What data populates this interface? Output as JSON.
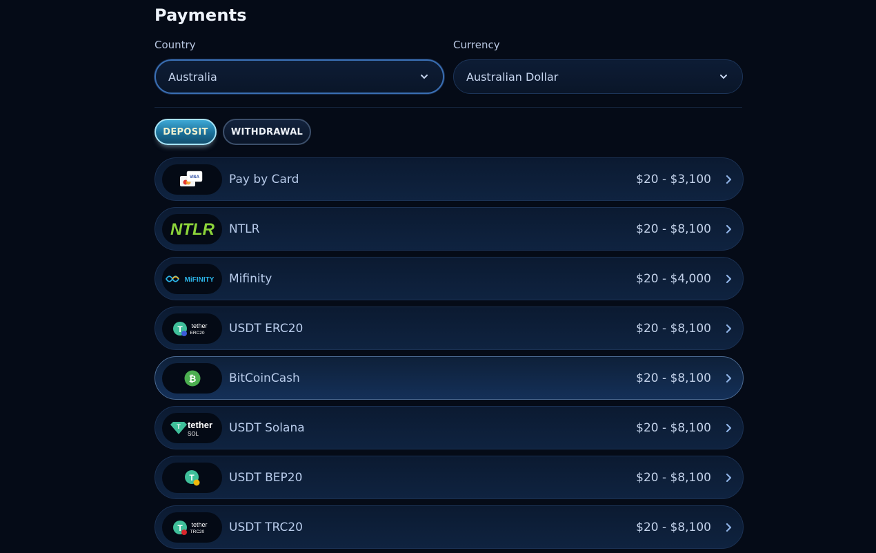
{
  "title": "Payments",
  "country": {
    "label": "Country",
    "value": "Australia"
  },
  "currency": {
    "label": "Currency",
    "value": "Australian Dollar"
  },
  "tabs": {
    "deposit": "DEPOSIT",
    "withdrawal": "WITHDRAWAL",
    "active": "deposit"
  },
  "methods": [
    {
      "name": "Pay by Card",
      "range": "$20 - $3,100",
      "logo": "visa-card-icon",
      "logo_text": "VISA"
    },
    {
      "name": "NTLR",
      "range": "$20 - $8,100",
      "logo": "ntlr-logo",
      "logo_text": "NTLR"
    },
    {
      "name": "Mifinity",
      "range": "$20 - $4,000",
      "logo": "mifinity-logo",
      "logo_text": "MiFINITY"
    },
    {
      "name": "USDT ERC20",
      "range": "$20 - $8,100",
      "logo": "tether-erc20-logo",
      "logo_text": "tether",
      "logo_sub": "ERC20"
    },
    {
      "name": "BitCoinCash",
      "range": "$20 - $8,100",
      "logo": "bitcoincash-icon",
      "logo_text": ""
    },
    {
      "name": "USDT Solana",
      "range": "$20 - $8,100",
      "logo": "tether-sol-logo",
      "logo_text": "tether",
      "logo_sub": "SOL"
    },
    {
      "name": "USDT BEP20",
      "range": "$20 - $8,100",
      "logo": "tether-bep20-icon",
      "logo_text": ""
    },
    {
      "name": "USDT TRC20",
      "range": "$20 - $8,100",
      "logo": "tether-trc20-logo",
      "logo_text": "tether",
      "logo_sub": "TRC20"
    }
  ],
  "highlighted_index": 4,
  "colors": {
    "background": "#050b17",
    "accent": "#3fa9d6",
    "ntlr_green": "#8cd43a",
    "tether_green": "#3fbf9a",
    "bch_green": "#4caf50"
  }
}
